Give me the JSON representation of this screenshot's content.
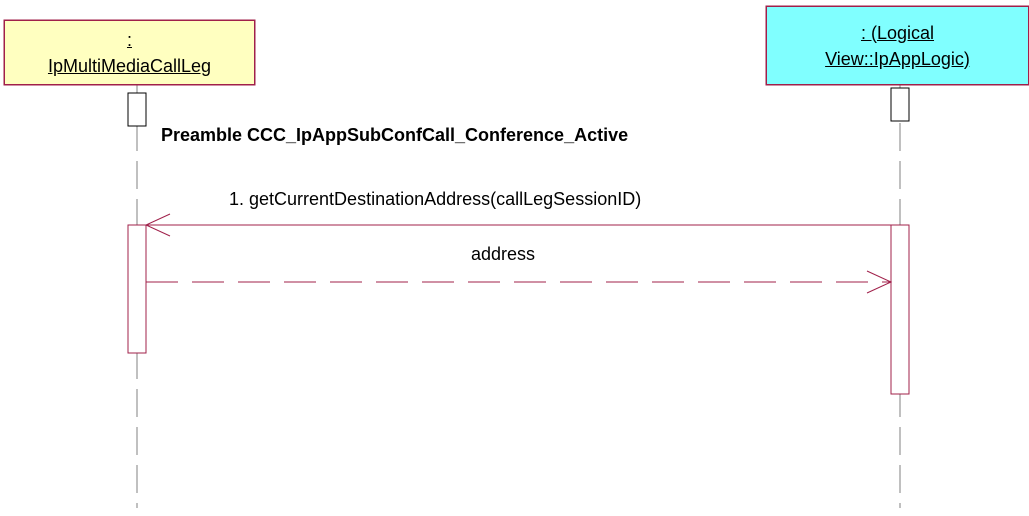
{
  "diagram": {
    "type": "sequence",
    "colors": {
      "line": "#a0204a",
      "left_object_fill": "#ffffc0",
      "right_object_fill": "#80ffff",
      "text": "#000000"
    },
    "objects": [
      {
        "id": "left",
        "line1": ":",
        "line2": "IpMultiMediaCallLeg"
      },
      {
        "id": "right",
        "line1": ": (Logical",
        "line2": "View::IpAppLogic)"
      }
    ],
    "preamble": "Preamble CCC_IpAppSubConfCall_Conference_Active",
    "messages": [
      {
        "label": "1. getCurrentDestinationAddress(callLegSessionID)",
        "style": "solid",
        "direction": "right-to-left"
      },
      {
        "label": "address",
        "style": "dashed",
        "direction": "left-to-right"
      }
    ]
  }
}
